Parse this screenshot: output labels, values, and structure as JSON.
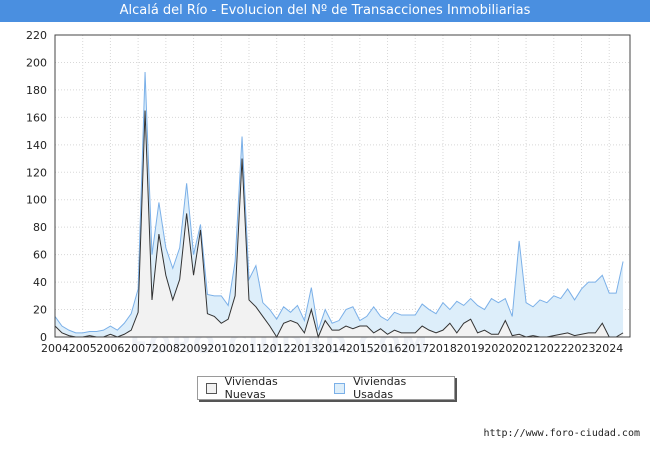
{
  "header": {
    "title": "Alcalá del Río - Evolucion del Nº de Transacciones Inmobiliarias"
  },
  "watermark": "FORO-CIUDAD.COM",
  "source": "http://www.foro-ciudad.com",
  "colors": {
    "title_bg": "#4a8fe0",
    "nuevas_fill": "#f2f2f2",
    "nuevas_line": "#333333",
    "usadas_fill": "#ddeefa",
    "usadas_line": "#7bb0e8",
    "grid": "#d8d8d8"
  },
  "chart_data": {
    "type": "area",
    "title": "Alcalá del Río - Evolucion del Nº de Transacciones Inmobiliarias",
    "xlabel": "",
    "ylabel": "",
    "ylim": [
      0,
      220
    ],
    "yticks": [
      0,
      20,
      40,
      60,
      80,
      100,
      120,
      140,
      160,
      180,
      200,
      220
    ],
    "xticks": [
      "2004",
      "2005",
      "2006",
      "2007",
      "2008",
      "2009",
      "2010",
      "2011",
      "2012",
      "2013",
      "2014",
      "2015",
      "2016",
      "2017",
      "2018",
      "2019",
      "2020",
      "2021",
      "2022",
      "2023",
      "2024"
    ],
    "x_start": 2004.0,
    "x_step": 0.25,
    "x_range": [
      2004.0,
      2024.75
    ],
    "grid": true,
    "legend_position": "bottom-center",
    "series": [
      {
        "name": "Viviendas Nuevas",
        "values": [
          8,
          3,
          1,
          0,
          0,
          1,
          0,
          0,
          2,
          0,
          2,
          5,
          18,
          165,
          27,
          75,
          45,
          27,
          42,
          90,
          45,
          78,
          17,
          15,
          10,
          13,
          30,
          130,
          27,
          22,
          15,
          8,
          0,
          10,
          12,
          10,
          3,
          20,
          0,
          12,
          5,
          5,
          8,
          6,
          8,
          8,
          3,
          6,
          2,
          5,
          3,
          3,
          3,
          8,
          5,
          3,
          5,
          10,
          3,
          10,
          13,
          3,
          5,
          2,
          2,
          12,
          1,
          2,
          0,
          1,
          0,
          0,
          1,
          2,
          3,
          1,
          2,
          3,
          3,
          10,
          0,
          0,
          3
        ]
      },
      {
        "name": "Viviendas Usadas",
        "values": [
          15,
          8,
          5,
          3,
          3,
          4,
          4,
          5,
          8,
          5,
          10,
          17,
          35,
          193,
          60,
          98,
          65,
          50,
          65,
          112,
          60,
          82,
          31,
          30,
          30,
          23,
          55,
          146,
          42,
          52,
          25,
          20,
          13,
          22,
          18,
          23,
          12,
          36,
          5,
          20,
          10,
          12,
          20,
          22,
          12,
          15,
          22,
          15,
          12,
          18,
          16,
          16,
          16,
          24,
          20,
          17,
          25,
          20,
          26,
          23,
          28,
          23,
          20,
          28,
          25,
          28,
          15,
          70,
          25,
          22,
          27,
          25,
          30,
          28,
          35,
          27,
          35,
          40,
          40,
          45,
          32,
          32,
          55
        ]
      }
    ]
  }
}
